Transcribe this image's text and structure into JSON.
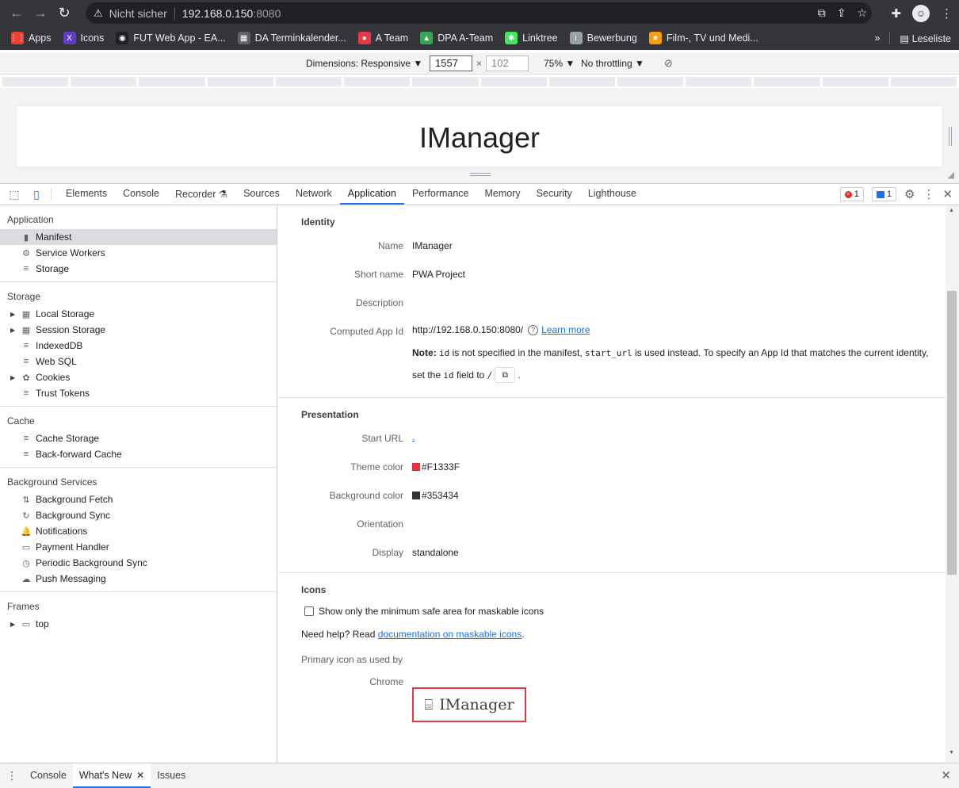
{
  "browser": {
    "back_icon": "←",
    "forward_icon": "→",
    "reload_icon": "↻",
    "security_label": "Nicht sicher",
    "url_host": "192.168.0.150",
    "url_port": ":8080",
    "bookmarks": [
      {
        "label": "Apps",
        "icon_color": "#ea4335",
        "glyph": "⋮⋮"
      },
      {
        "label": "Icons",
        "icon_color": "#5f3dc4",
        "glyph": "X"
      },
      {
        "label": "FUT Web App - EA...",
        "icon_color": "#202124",
        "glyph": "◉"
      },
      {
        "label": "DA Terminkalender...",
        "icon_color": "#5f6368",
        "glyph": "▦"
      },
      {
        "label": "A Team",
        "icon_color": "#e53946",
        "glyph": "●"
      },
      {
        "label": "DPA A-Team",
        "icon_color": "#34a853",
        "glyph": "▲"
      },
      {
        "label": "Linktree",
        "icon_color": "#43e55e",
        "glyph": "✱"
      },
      {
        "label": "Bewerbung",
        "icon_color": "#9aa0a6",
        "glyph": "i"
      },
      {
        "label": "Film-, TV und Medi...",
        "icon_color": "#f59e0b",
        "glyph": "★"
      }
    ],
    "more_label": "»",
    "reading_list_label": "Leseliste"
  },
  "device_toolbar": {
    "dimensions_label": "Dimensions: Responsive ▼",
    "width_value": "1557",
    "times": "×",
    "height_placeholder": "102",
    "zoom_label": "75% ▼",
    "throttling_label": "No throttling ▼"
  },
  "page": {
    "title": "IManager"
  },
  "devtools": {
    "tabs": [
      "Elements",
      "Console",
      "Recorder ⚗",
      "Sources",
      "Network",
      "Application",
      "Performance",
      "Memory",
      "Security",
      "Lighthouse"
    ],
    "active_tab": "Application",
    "error_count": "1",
    "message_count": "1"
  },
  "sidebar": {
    "sections": [
      {
        "title": "Application",
        "items": [
          {
            "label": "Manifest",
            "icon": "▮",
            "selected": true,
            "expandable": false
          },
          {
            "label": "Service Workers",
            "icon": "⚙",
            "selected": false,
            "expandable": false
          },
          {
            "label": "Storage",
            "icon": "≡",
            "selected": false,
            "expandable": false
          }
        ]
      },
      {
        "title": "Storage",
        "items": [
          {
            "label": "Local Storage",
            "icon": "▦",
            "selected": false,
            "expandable": true
          },
          {
            "label": "Session Storage",
            "icon": "▦",
            "selected": false,
            "expandable": true
          },
          {
            "label": "IndexedDB",
            "icon": "≡",
            "selected": false,
            "expandable": false
          },
          {
            "label": "Web SQL",
            "icon": "≡",
            "selected": false,
            "expandable": false
          },
          {
            "label": "Cookies",
            "icon": "✿",
            "selected": false,
            "expandable": true
          },
          {
            "label": "Trust Tokens",
            "icon": "≡",
            "selected": false,
            "expandable": false
          }
        ]
      },
      {
        "title": "Cache",
        "items": [
          {
            "label": "Cache Storage",
            "icon": "≡",
            "selected": false,
            "expandable": false
          },
          {
            "label": "Back-forward Cache",
            "icon": "≡",
            "selected": false,
            "expandable": false
          }
        ]
      },
      {
        "title": "Background Services",
        "items": [
          {
            "label": "Background Fetch",
            "icon": "⇅",
            "selected": false,
            "expandable": false
          },
          {
            "label": "Background Sync",
            "icon": "↻",
            "selected": false,
            "expandable": false
          },
          {
            "label": "Notifications",
            "icon": "🔔",
            "selected": false,
            "expandable": false
          },
          {
            "label": "Payment Handler",
            "icon": "▭",
            "selected": false,
            "expandable": false
          },
          {
            "label": "Periodic Background Sync",
            "icon": "◷",
            "selected": false,
            "expandable": false
          },
          {
            "label": "Push Messaging",
            "icon": "☁",
            "selected": false,
            "expandable": false
          }
        ]
      },
      {
        "title": "Frames",
        "items": [
          {
            "label": "top",
            "icon": "▭",
            "selected": false,
            "expandable": true
          }
        ]
      }
    ]
  },
  "manifest": {
    "identity": {
      "title": "Identity",
      "name_label": "Name",
      "name_value": "IManager",
      "short_name_label": "Short name",
      "short_name_value": "PWA Project",
      "description_label": "Description",
      "computed_id_label": "Computed App Id",
      "computed_id_value": "http://192.168.0.150:8080/",
      "learn_more": "Learn more",
      "note_bold": "Note:",
      "note_code1": "id",
      "note_text1": "is not specified in the manifest,",
      "note_code2": "start_url",
      "note_text2": "is used instead. To specify an App Id that matches the current identity,",
      "note_line2a": "set the",
      "note_code3": "id",
      "note_line2b": "field to",
      "note_code4": "/",
      "note_period": "."
    },
    "presentation": {
      "title": "Presentation",
      "start_url_label": "Start URL",
      "start_url_value": ".",
      "theme_color_label": "Theme color",
      "theme_color_value": "#F1333F",
      "background_color_label": "Background color",
      "background_color_value": "#353434",
      "orientation_label": "Orientation",
      "display_label": "Display",
      "display_value": "standalone"
    },
    "icons": {
      "title": "Icons",
      "checkbox_label": "Show only the minimum safe area for maskable icons",
      "help_prefix": "Need help? Read",
      "help_link": "documentation on maskable icons",
      "help_suffix": ".",
      "primary_label_1": "Primary icon as used by",
      "primary_label_2": "Chrome",
      "icon_text": "IManager"
    }
  },
  "drawer": {
    "tabs": [
      "Console",
      "What's New",
      "Issues"
    ],
    "active_tab": "What's New"
  }
}
